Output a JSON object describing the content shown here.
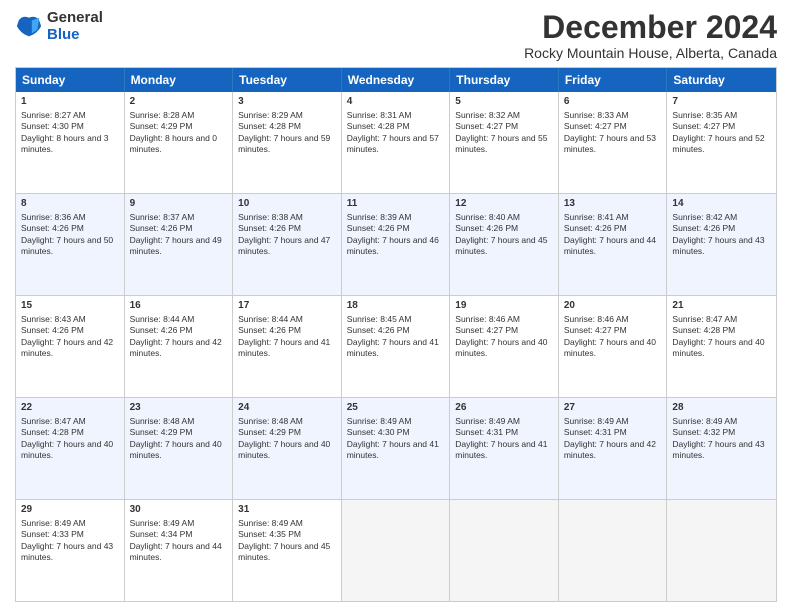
{
  "logo": {
    "general": "General",
    "blue": "Blue"
  },
  "title": "December 2024",
  "location": "Rocky Mountain House, Alberta, Canada",
  "days": [
    "Sunday",
    "Monday",
    "Tuesday",
    "Wednesday",
    "Thursday",
    "Friday",
    "Saturday"
  ],
  "rows": [
    [
      {
        "day": "1",
        "sunrise": "8:27 AM",
        "sunset": "4:30 PM",
        "daylight": "8 hours and 3 minutes."
      },
      {
        "day": "2",
        "sunrise": "8:28 AM",
        "sunset": "4:29 PM",
        "daylight": "8 hours and 0 minutes."
      },
      {
        "day": "3",
        "sunrise": "8:29 AM",
        "sunset": "4:28 PM",
        "daylight": "7 hours and 59 minutes."
      },
      {
        "day": "4",
        "sunrise": "8:31 AM",
        "sunset": "4:28 PM",
        "daylight": "7 hours and 57 minutes."
      },
      {
        "day": "5",
        "sunrise": "8:32 AM",
        "sunset": "4:27 PM",
        "daylight": "7 hours and 55 minutes."
      },
      {
        "day": "6",
        "sunrise": "8:33 AM",
        "sunset": "4:27 PM",
        "daylight": "7 hours and 53 minutes."
      },
      {
        "day": "7",
        "sunrise": "8:35 AM",
        "sunset": "4:27 PM",
        "daylight": "7 hours and 52 minutes."
      }
    ],
    [
      {
        "day": "8",
        "sunrise": "8:36 AM",
        "sunset": "4:26 PM",
        "daylight": "7 hours and 50 minutes."
      },
      {
        "day": "9",
        "sunrise": "8:37 AM",
        "sunset": "4:26 PM",
        "daylight": "7 hours and 49 minutes."
      },
      {
        "day": "10",
        "sunrise": "8:38 AM",
        "sunset": "4:26 PM",
        "daylight": "7 hours and 47 minutes."
      },
      {
        "day": "11",
        "sunrise": "8:39 AM",
        "sunset": "4:26 PM",
        "daylight": "7 hours and 46 minutes."
      },
      {
        "day": "12",
        "sunrise": "8:40 AM",
        "sunset": "4:26 PM",
        "daylight": "7 hours and 45 minutes."
      },
      {
        "day": "13",
        "sunrise": "8:41 AM",
        "sunset": "4:26 PM",
        "daylight": "7 hours and 44 minutes."
      },
      {
        "day": "14",
        "sunrise": "8:42 AM",
        "sunset": "4:26 PM",
        "daylight": "7 hours and 43 minutes."
      }
    ],
    [
      {
        "day": "15",
        "sunrise": "8:43 AM",
        "sunset": "4:26 PM",
        "daylight": "7 hours and 42 minutes."
      },
      {
        "day": "16",
        "sunrise": "8:44 AM",
        "sunset": "4:26 PM",
        "daylight": "7 hours and 42 minutes."
      },
      {
        "day": "17",
        "sunrise": "8:44 AM",
        "sunset": "4:26 PM",
        "daylight": "7 hours and 41 minutes."
      },
      {
        "day": "18",
        "sunrise": "8:45 AM",
        "sunset": "4:26 PM",
        "daylight": "7 hours and 41 minutes."
      },
      {
        "day": "19",
        "sunrise": "8:46 AM",
        "sunset": "4:27 PM",
        "daylight": "7 hours and 40 minutes."
      },
      {
        "day": "20",
        "sunrise": "8:46 AM",
        "sunset": "4:27 PM",
        "daylight": "7 hours and 40 minutes."
      },
      {
        "day": "21",
        "sunrise": "8:47 AM",
        "sunset": "4:28 PM",
        "daylight": "7 hours and 40 minutes."
      }
    ],
    [
      {
        "day": "22",
        "sunrise": "8:47 AM",
        "sunset": "4:28 PM",
        "daylight": "7 hours and 40 minutes."
      },
      {
        "day": "23",
        "sunrise": "8:48 AM",
        "sunset": "4:29 PM",
        "daylight": "7 hours and 40 minutes."
      },
      {
        "day": "24",
        "sunrise": "8:48 AM",
        "sunset": "4:29 PM",
        "daylight": "7 hours and 40 minutes."
      },
      {
        "day": "25",
        "sunrise": "8:49 AM",
        "sunset": "4:30 PM",
        "daylight": "7 hours and 41 minutes."
      },
      {
        "day": "26",
        "sunrise": "8:49 AM",
        "sunset": "4:31 PM",
        "daylight": "7 hours and 41 minutes."
      },
      {
        "day": "27",
        "sunrise": "8:49 AM",
        "sunset": "4:31 PM",
        "daylight": "7 hours and 42 minutes."
      },
      {
        "day": "28",
        "sunrise": "8:49 AM",
        "sunset": "4:32 PM",
        "daylight": "7 hours and 43 minutes."
      }
    ],
    [
      {
        "day": "29",
        "sunrise": "8:49 AM",
        "sunset": "4:33 PM",
        "daylight": "7 hours and 43 minutes."
      },
      {
        "day": "30",
        "sunrise": "8:49 AM",
        "sunset": "4:34 PM",
        "daylight": "7 hours and 44 minutes."
      },
      {
        "day": "31",
        "sunrise": "8:49 AM",
        "sunset": "4:35 PM",
        "daylight": "7 hours and 45 minutes."
      },
      null,
      null,
      null,
      null
    ]
  ]
}
